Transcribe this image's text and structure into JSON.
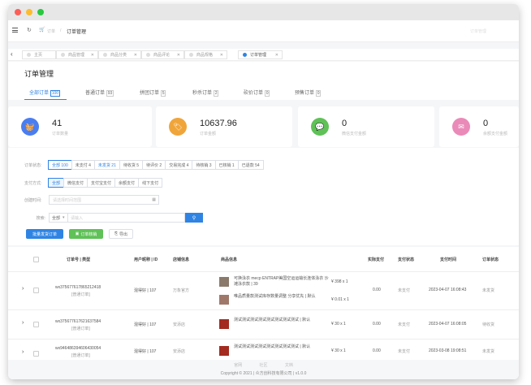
{
  "nav": {
    "breadcrumb_parent": "订单",
    "breadcrumb_sep": "/",
    "breadcrumb_current": "订单管理",
    "right_text": "订单管理"
  },
  "tabs": [
    {
      "label": "主页"
    },
    {
      "label": "商品管理"
    },
    {
      "label": "商品分类"
    },
    {
      "label": "商品评论"
    },
    {
      "label": "商品规格"
    },
    {
      "label": "订单管理"
    }
  ],
  "page": {
    "title": "订单管理",
    "status_tabs": [
      {
        "label": "全部订单",
        "count": "100"
      },
      {
        "label": "普通订单",
        "count": "93"
      },
      {
        "label": "拼团订单",
        "count": "5"
      },
      {
        "label": "秒杀订单",
        "count": "2"
      },
      {
        "label": "砍价订单",
        "count": "0"
      },
      {
        "label": "预售订单",
        "count": "0"
      }
    ]
  },
  "stats": [
    {
      "value": "41",
      "label": "订单数量",
      "icon": "basket-icon",
      "color": "#4a7ef0"
    },
    {
      "value": "10637.96",
      "label": "订单金额",
      "icon": "tag-icon",
      "color": "#f0a53a"
    },
    {
      "value": "0",
      "label": "微信支付金额",
      "icon": "wechat-icon",
      "color": "#5fc157"
    },
    {
      "value": "0",
      "label": "余额支付金额",
      "icon": "wallet-icon",
      "color": "#ea8ab8"
    }
  ],
  "filters": {
    "order_status_label": "订单状态:",
    "order_status_options": [
      "全部 100",
      "未支付 4",
      "未发货 21",
      "待收货 5",
      "待评价 2",
      "交易完成 4",
      "待核销 3",
      "已核销 1",
      "已退款 54"
    ],
    "pay_type_label": "支付方式:",
    "pay_type_options": [
      "全部",
      "微信支付",
      "支付宝支付",
      "余额支付",
      "线下支付"
    ],
    "date_label": "创建时间:",
    "date_placeholder": "请选择时间范围",
    "search_label": "搜索:",
    "search_select": "全部",
    "search_placeholder": "请输入",
    "btn_batch_ship": "批量发货订单",
    "btn_order_verify": "订单核销",
    "btn_export": "导出"
  },
  "table": {
    "headers": [
      "订单号 | 类型",
      "用户昵称 | ID",
      "店铺信息",
      "商品信息",
      "实际支付",
      "支付状态",
      "支付时间",
      "订单状态"
    ],
    "rows": [
      {
        "order_no": "wx375677617865212418",
        "type": "[普通订单]",
        "user": "混得好 | 107",
        "shop": "万象官方",
        "goods": [
          {
            "name": "可换泳衣 mecp ENTRAP美国空运运输长连体泳衣 沙滩泳衣款 | 39",
            "qty": "¥ 398 x 1"
          },
          {
            "name": "唯品质量款测试库存数量调整 分享优先 | 默认",
            "qty": "¥ 0.01 x 1"
          }
        ],
        "paid": "0.00",
        "pay_status": "未支付",
        "pay_time": "2023-04-07 16:08:43",
        "order_status": "未发货"
      },
      {
        "order_no": "wx375677617621637584",
        "type": "[普通订单]",
        "user": "混得好 | 107",
        "shop": "安添店",
        "goods": [
          {
            "name": "测试测试测试测试测试测试测试测试 | 默认",
            "qty": "¥ 30 x 1"
          }
        ],
        "paid": "0.00",
        "pay_status": "未支付",
        "pay_time": "2023-04-07 16:08:05",
        "order_status": "待收货"
      },
      {
        "order_no": "wx946486394606430054",
        "type": "[普通订单]",
        "user": "混得好 | 107",
        "shop": "安添店",
        "goods": [
          {
            "name": "测试测试测试测试测试测试测试测试 | 默认",
            "qty": "¥ 30 x 1"
          }
        ],
        "paid": "0.00",
        "pay_status": "未支付",
        "pay_time": "2023-03-08 19:08:51",
        "order_status": "未发货"
      }
    ]
  },
  "footer": {
    "links": [
      "官网",
      "社区",
      "文档"
    ],
    "copyright": "Copyright © 2021 | 众方创科技有限公司 | v1.0.0"
  }
}
